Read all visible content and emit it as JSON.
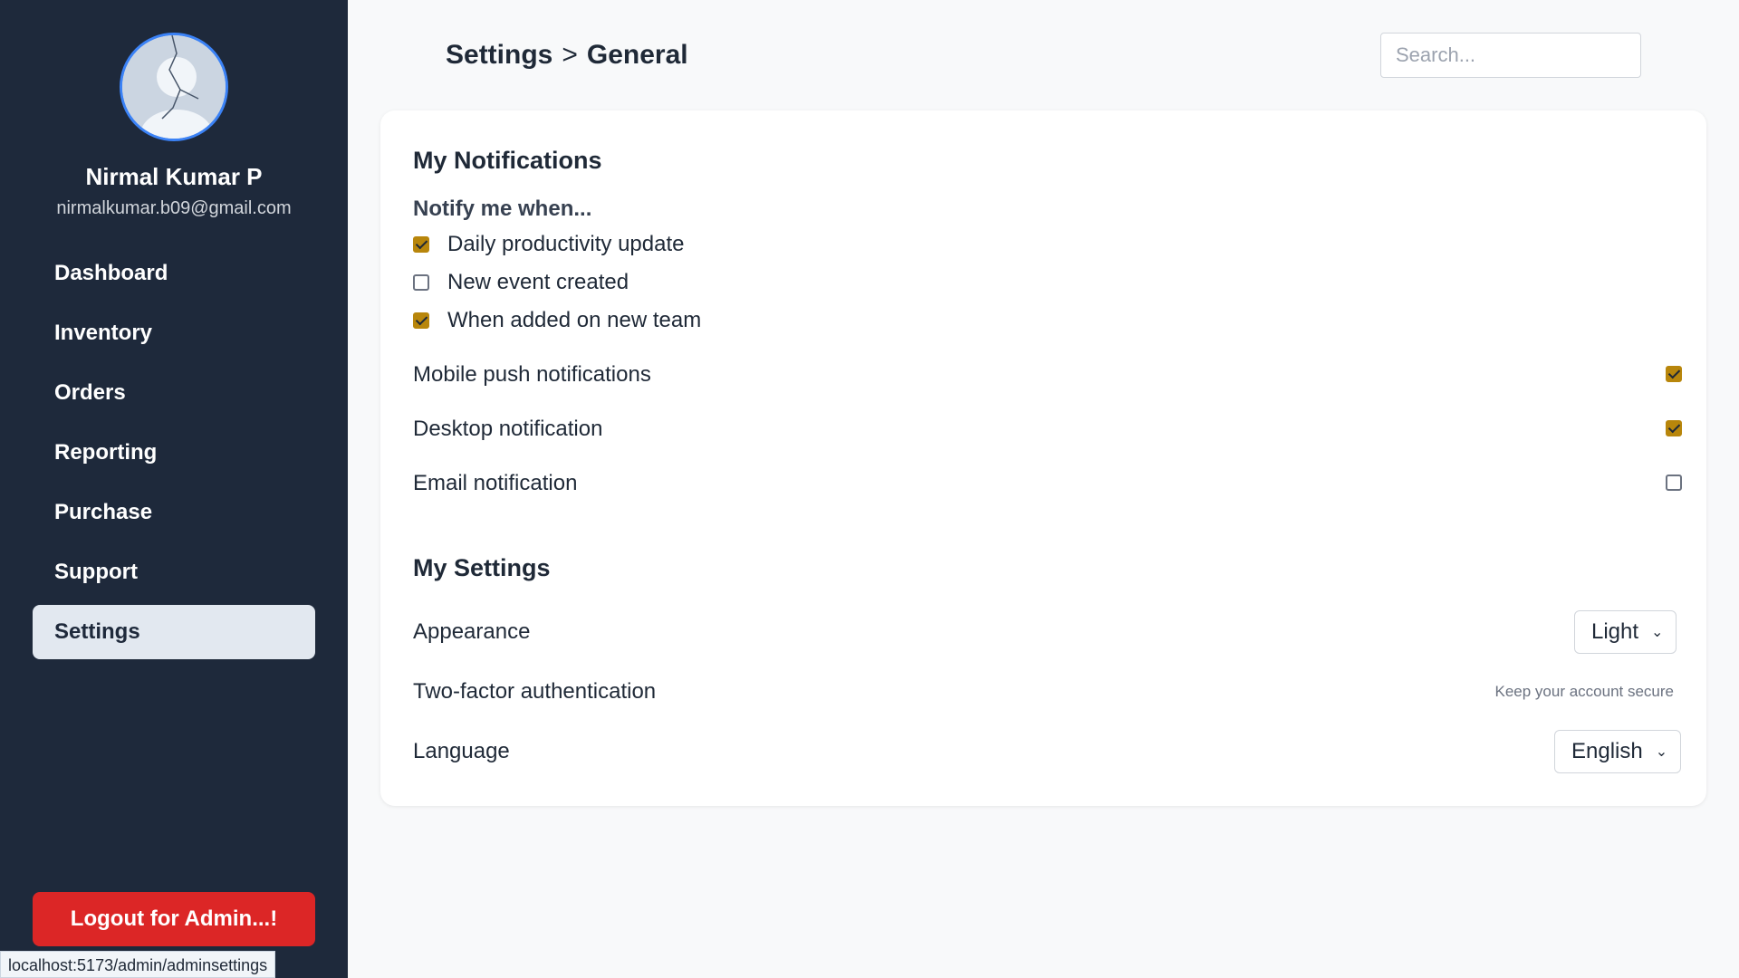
{
  "profile": {
    "name": "Nirmal Kumar P",
    "email": "nirmalkumar.b09@gmail.com"
  },
  "sidebar": {
    "items": [
      {
        "label": "Dashboard"
      },
      {
        "label": "Inventory"
      },
      {
        "label": "Orders"
      },
      {
        "label": "Reporting"
      },
      {
        "label": "Purchase"
      },
      {
        "label": "Support"
      },
      {
        "label": "Settings",
        "active": true
      }
    ],
    "logout_label": "Logout for Admin...!"
  },
  "status_bar": {
    "url": "localhost:5173/admin/adminsettings"
  },
  "header": {
    "breadcrumb": [
      "Settings",
      ">",
      "General"
    ],
    "search_placeholder": "Search..."
  },
  "notifications": {
    "title": "My Notifications",
    "subheading": "Notify me when...",
    "options": [
      {
        "label": "Daily productivity update",
        "checked": true
      },
      {
        "label": "New event created",
        "checked": false
      },
      {
        "label": "When added on new team",
        "checked": true
      }
    ],
    "prefs": [
      {
        "label": "Mobile push notifications",
        "checked": true
      },
      {
        "label": "Desktop notification",
        "checked": true
      },
      {
        "label": "Email notification",
        "checked": false
      }
    ]
  },
  "settings": {
    "title": "My Settings",
    "appearance": {
      "label": "Appearance",
      "value": "Light"
    },
    "two_factor": {
      "label": "Two-factor authentication",
      "hint": "Keep your account secure"
    },
    "language": {
      "label": "Language",
      "value": "English"
    }
  },
  "colors": {
    "sidebar_bg": "#1e293b",
    "logout_bg": "#dc2626",
    "checkbox_accent": "#b8860b",
    "active_nav_bg": "#e2e8f0"
  }
}
